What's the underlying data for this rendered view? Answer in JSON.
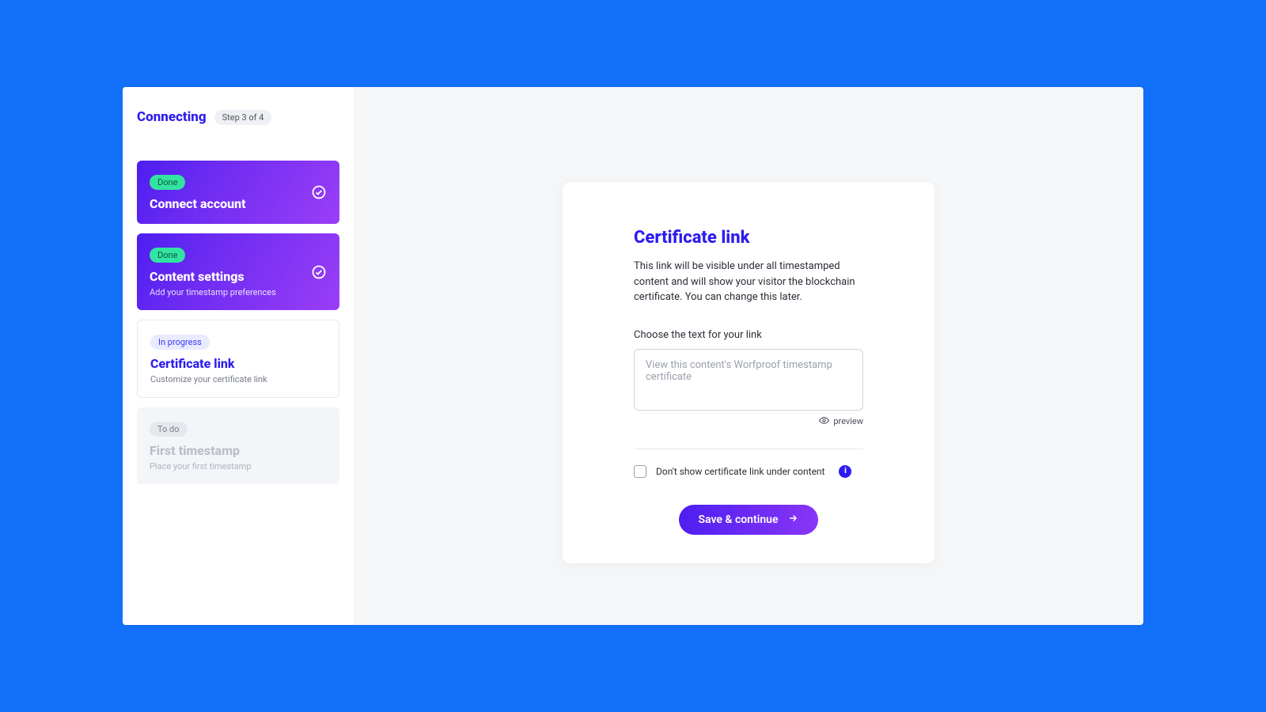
{
  "sidebar": {
    "title": "Connecting",
    "step_indicator": "Step 3 of 4",
    "steps": [
      {
        "status": "Done",
        "title": "Connect account"
      },
      {
        "status": "Done",
        "title": "Content settings",
        "sub": "Add your timestamp preferences"
      },
      {
        "status": "In progress",
        "title": "Certificate link",
        "sub": "Customize your certificate link"
      },
      {
        "status": "To do",
        "title": "First timestamp",
        "sub": "Place your first timestamp"
      }
    ]
  },
  "main": {
    "heading": "Certificate link",
    "description": "This link will be visible under all timestamped content and will show your visitor the blockchain certificate. You can change this later.",
    "text_field_label": "Choose the text for your link",
    "text_field_placeholder": "View this content's Worfproof timestamp certificate",
    "preview_label": "preview",
    "checkbox_label": "Don't show certificate link under content",
    "info_glyph": "i",
    "cta_label": "Save & continue"
  }
}
